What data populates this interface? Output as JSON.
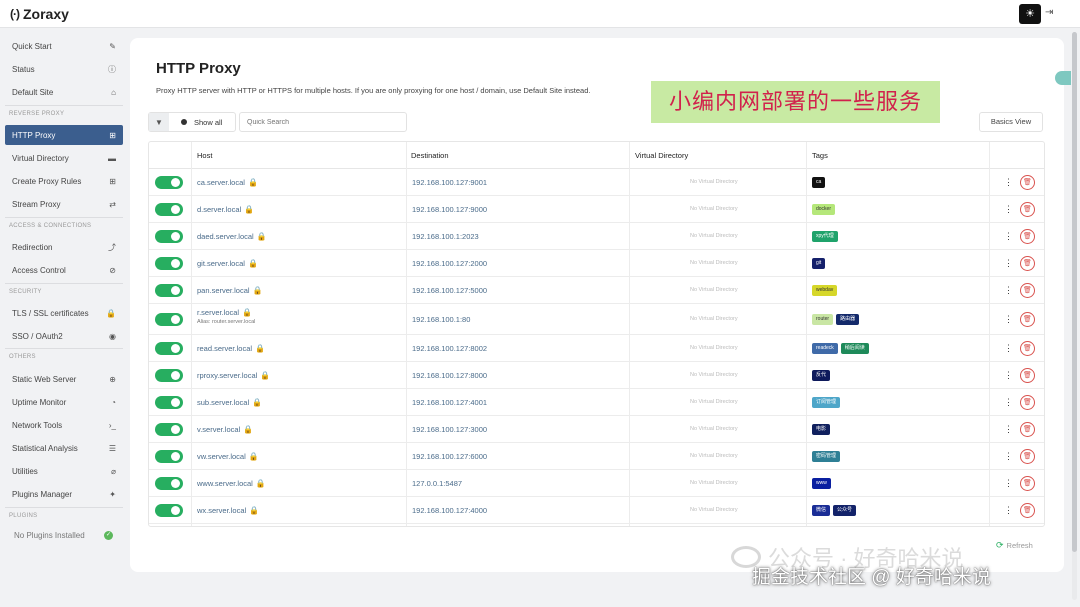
{
  "app": {
    "name": "Zoraxy"
  },
  "sidebar": {
    "items": [
      {
        "label": "Quick Start",
        "icon": "wand-icon"
      },
      {
        "label": "Status",
        "icon": "info-icon"
      },
      {
        "label": "Default Site",
        "icon": "home-icon"
      },
      {
        "label": "HTTP Proxy",
        "icon": "sitemap-icon",
        "active": true
      },
      {
        "label": "Virtual Directory",
        "icon": "folder-icon"
      },
      {
        "label": "Create Proxy Rules",
        "icon": "plus-square-icon"
      },
      {
        "label": "Stream Proxy",
        "icon": "exchange-icon"
      },
      {
        "label": "Redirection",
        "icon": "redirect-icon"
      },
      {
        "label": "Access Control",
        "icon": "ban-icon"
      },
      {
        "label": "TLS / SSL certificates",
        "icon": "lock-icon"
      },
      {
        "label": "SSO / OAuth2",
        "icon": "user-circle-icon"
      },
      {
        "label": "Static Web Server",
        "icon": "globe-icon"
      },
      {
        "label": "Uptime Monitor",
        "icon": "clock-icon"
      },
      {
        "label": "Network Tools",
        "icon": "terminal-icon"
      },
      {
        "label": "Statistical Analysis",
        "icon": "database-icon"
      },
      {
        "label": "Utilities",
        "icon": "paperclip-icon"
      },
      {
        "label": "Plugins Manager",
        "icon": "puzzle-icon"
      }
    ],
    "sections": {
      "reverse_proxy": "REVERSE PROXY",
      "access": "ACCESS & CONNECTIONS",
      "security": "SECURITY",
      "others": "OTHERS",
      "plugins": "PLUGINS"
    },
    "no_plugins": "No Plugins Installed"
  },
  "main": {
    "title": "HTTP Proxy",
    "description": "Proxy HTTP server with HTTP or HTTPS for multiple hosts. If you are only proxying for one host / domain, use Default Site instead.",
    "banner": "小编内网部署的一些服务",
    "filter_label": "Show all",
    "search_placeholder": "Quick Search",
    "basics_view": "Basics View",
    "refresh": "Refresh"
  },
  "table": {
    "headers": [
      "Host",
      "Destination",
      "Virtual Directory",
      "Tags"
    ],
    "no_vdir": "No Virtual Directory",
    "rows": [
      {
        "host": "ca.server.local",
        "dest": "192.168.100.127:9001",
        "tags": [
          {
            "t": "ca",
            "c": "#111111"
          }
        ]
      },
      {
        "host": "d.server.local",
        "dest": "192.168.100.127:9000",
        "tags": [
          {
            "t": "docker",
            "c": "#b5e77a",
            "dark": true
          }
        ]
      },
      {
        "host": "daed.server.local",
        "dest": "192.168.100.1:2023",
        "tags": [
          {
            "t": "xpy代理",
            "c": "#1fa36b"
          }
        ]
      },
      {
        "host": "git.server.local",
        "dest": "192.168.100.127:2000",
        "tags": [
          {
            "t": "git",
            "c": "#15206b"
          }
        ]
      },
      {
        "host": "pan.server.local",
        "dest": "192.168.100.127:5000",
        "tags": [
          {
            "t": "webdav",
            "c": "#d6d72a",
            "dark": true
          }
        ]
      },
      {
        "host": "r.server.local",
        "alias": "Alias: router.server.local",
        "dest": "192.168.100.1:80",
        "tags": [
          {
            "t": "router",
            "c": "#c9e6a4",
            "dark": true
          },
          {
            "t": "路由器",
            "c": "#142a6b"
          }
        ]
      },
      {
        "host": "read.server.local",
        "dest": "192.168.100.127:8002",
        "tags": [
          {
            "t": "readeck",
            "c": "#3f6aa8"
          },
          {
            "t": "稍后阅读",
            "c": "#1e8a5a"
          }
        ]
      },
      {
        "host": "rproxy.server.local",
        "dest": "192.168.100.127:8000",
        "tags": [
          {
            "t": "反代",
            "c": "#0e1a5c"
          }
        ]
      },
      {
        "host": "sub.server.local",
        "dest": "192.168.100.127:4001",
        "tags": [
          {
            "t": "订阅管理",
            "c": "#4ea6c9"
          }
        ]
      },
      {
        "host": "v.server.local",
        "dest": "192.168.100.127:3000",
        "tags": [
          {
            "t": "电影",
            "c": "#10205e"
          }
        ]
      },
      {
        "host": "vw.server.local",
        "dest": "192.168.100.127:6000",
        "tags": [
          {
            "t": "密码管理",
            "c": "#2e7f95"
          }
        ]
      },
      {
        "host": "www.server.local",
        "dest": "127.0.0.1:5487",
        "tags": [
          {
            "t": "www",
            "c": "#0a1fa0"
          }
        ]
      },
      {
        "host": "wx.server.local",
        "dest": "192.168.100.127:4000",
        "tags": [
          {
            "t": "微信",
            "c": "#1a2d96"
          },
          {
            "t": "公众号",
            "c": "#13236a"
          }
        ]
      }
    ]
  },
  "watermark": {
    "line1": "公众号 · 好奇哈米说",
    "line2": "掘金技术社区 @ 好奇哈米说"
  }
}
